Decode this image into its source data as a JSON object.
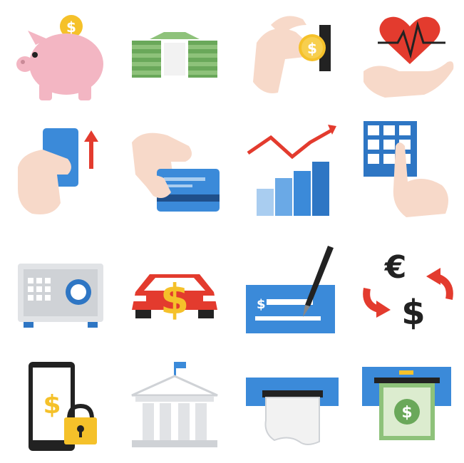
{
  "icons": [
    {
      "name": "piggy-bank-icon",
      "symbol": "$"
    },
    {
      "name": "cash-stack-icon",
      "symbol": ""
    },
    {
      "name": "coin-insert-icon",
      "symbol": "$"
    },
    {
      "name": "health-hand-icon",
      "symbol": ""
    },
    {
      "name": "card-up-icon",
      "symbol": ""
    },
    {
      "name": "card-swipe-icon",
      "symbol": ""
    },
    {
      "name": "growth-chart-icon",
      "symbol": ""
    },
    {
      "name": "keypad-icon",
      "symbol": ""
    },
    {
      "name": "safe-icon",
      "symbol": ""
    },
    {
      "name": "car-loan-icon",
      "symbol": "$"
    },
    {
      "name": "check-sign-icon",
      "symbol": "$"
    },
    {
      "name": "currency-exchange-icon",
      "symbols": [
        "€",
        "$"
      ]
    },
    {
      "name": "mobile-lock-icon",
      "symbol": "$"
    },
    {
      "name": "bank-building-icon",
      "symbol": ""
    },
    {
      "name": "receipt-atm-icon",
      "symbol": ""
    },
    {
      "name": "cash-atm-icon",
      "symbol": "$"
    }
  ],
  "colors": {
    "blue": "#2e76c4",
    "red": "#e33b2e",
    "gold": "#f5c12a",
    "pink": "#f3b6c3",
    "skin": "#f7d9c9",
    "green": "#6aa85a",
    "grey": "#d7d9dc",
    "dark": "#222222"
  },
  "text": {
    "piggy_symbol": "$",
    "coin_symbol": "$",
    "car_symbol": "$",
    "check_symbol": "$",
    "euro_symbol": "€",
    "dollar_symbol": "$",
    "mobile_symbol": "$",
    "atm_symbol": "$"
  }
}
